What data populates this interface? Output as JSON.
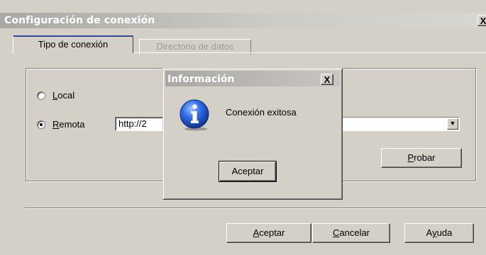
{
  "window": {
    "title": "Configuración de conexión",
    "close_symbol": "X"
  },
  "tabs": [
    {
      "label": "Tipo de conexión",
      "active": true
    },
    {
      "label": "Directorio de datos",
      "active": false
    }
  ],
  "connection": {
    "local_label": "Local",
    "local_accel": "L",
    "local_rest": "ocal",
    "remote_label": "Remota",
    "remote_accel": "R",
    "remote_rest": "emota",
    "selected": "Remota",
    "url_value": "http://2",
    "probar_accel": "P",
    "probar_rest": "robar"
  },
  "footer": {
    "aceptar_accel": "A",
    "aceptar_rest": "ceptar",
    "cancelar_accel": "C",
    "cancelar_rest": "ancelar",
    "ayuda_pre": "A",
    "ayuda_accel": "y",
    "ayuda_rest": "uda"
  },
  "dialog": {
    "title": "Información",
    "message": "Conexión exitosa",
    "ok_label": "Aceptar",
    "close_symbol": "X",
    "icon": "info-icon"
  },
  "colors": {
    "face": "#d4d0c8",
    "active_tab_accent": "#314a9c",
    "info_icon_blue": "#1c52c8"
  }
}
